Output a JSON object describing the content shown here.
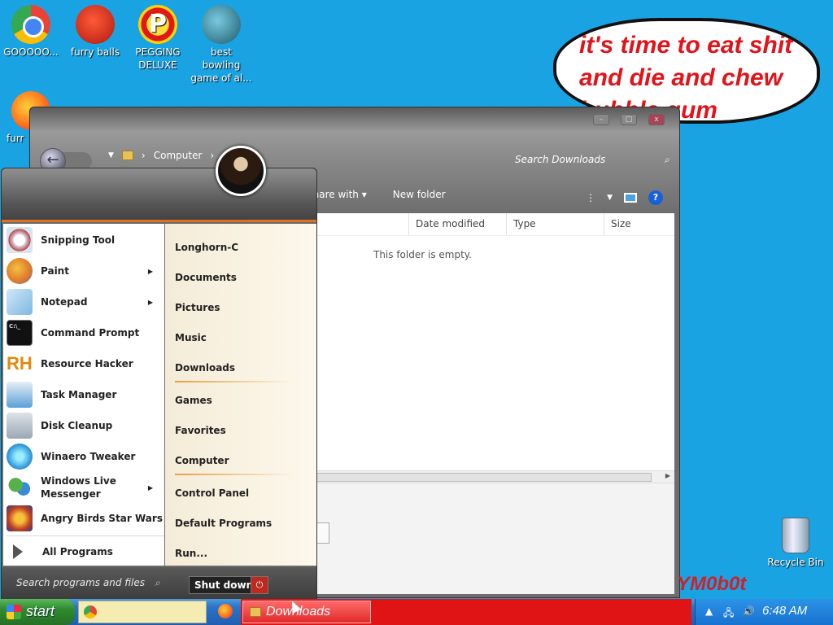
{
  "desktop": {
    "icons": [
      {
        "label": "GOOOOO...",
        "icon": "chrome-icon"
      },
      {
        "label": "furry balls",
        "icon": "furry-balls-icon"
      },
      {
        "label": "PEGGING DELUXE",
        "icon": "pegging-icon",
        "glyph": "P"
      },
      {
        "label": "best bowling game of al...",
        "icon": "bowling-game-icon"
      },
      {
        "label": "furr",
        "icon": "firefox-icon"
      }
    ],
    "bubble_text": "it's time to eat shit and die and chew bubble gum",
    "graffiti_text": "YM0b0t",
    "recycle_bin": "Recycle Bin"
  },
  "explorer": {
    "window_buttons": [
      "–",
      "□",
      "x"
    ],
    "breadcrumb": [
      "Computer",
      "›"
    ],
    "search_placeholder": "Search Downloads",
    "toolbar": {
      "share": "Share with ▾",
      "new_folder": "New folder"
    },
    "columns": [
      "Date modified",
      "Type",
      "Size"
    ],
    "empty_message": "This folder is empty."
  },
  "start_menu": {
    "programs": [
      {
        "label": "Snipping Tool",
        "icon": "snipping-tool-icon",
        "submenu": false,
        "color": "#d9e4f2"
      },
      {
        "label": "Paint",
        "icon": "paint-icon",
        "submenu": true,
        "color": "#f2c240"
      },
      {
        "label": "Notepad",
        "icon": "notepad-icon",
        "submenu": true,
        "color": "#7fb8e0"
      },
      {
        "label": "Command Prompt",
        "icon": "command-prompt-icon",
        "submenu": false,
        "color": "#111111"
      },
      {
        "label": "Resource Hacker",
        "icon": "resource-hacker-icon",
        "submenu": false,
        "color": "#f0a020"
      },
      {
        "label": "Task Manager",
        "icon": "task-manager-icon",
        "submenu": false,
        "color": "#5aa0d8"
      },
      {
        "label": "Disk Cleanup",
        "icon": "disk-cleanup-icon",
        "submenu": false,
        "color": "#9aa8b4"
      },
      {
        "label": "Winaero Tweaker",
        "icon": "winaero-tweaker-icon",
        "submenu": false,
        "color": "#3aa0e0"
      },
      {
        "label": "Windows Live Messenger",
        "icon": "messenger-icon",
        "submenu": true,
        "color": "#58b04a"
      },
      {
        "label": "Angry Birds Star Wars",
        "icon": "angry-birds-icon",
        "submenu": false,
        "color": "#c04020"
      }
    ],
    "all_programs": "All Programs",
    "places": [
      "Longhorn-C",
      "Documents",
      "Pictures",
      "Music",
      "Downloads",
      "Games",
      "Favorites",
      "Computer",
      "Control Panel",
      "Default Programs",
      "Run..."
    ],
    "search_placeholder": "Search programs and files",
    "shutdown_label": "Shut down"
  },
  "taskbar": {
    "start_label": "start",
    "active_task": "Downloads",
    "clock": "6:48 AM",
    "tray_icons": [
      "▲",
      "network-icon",
      "volume-icon"
    ]
  }
}
